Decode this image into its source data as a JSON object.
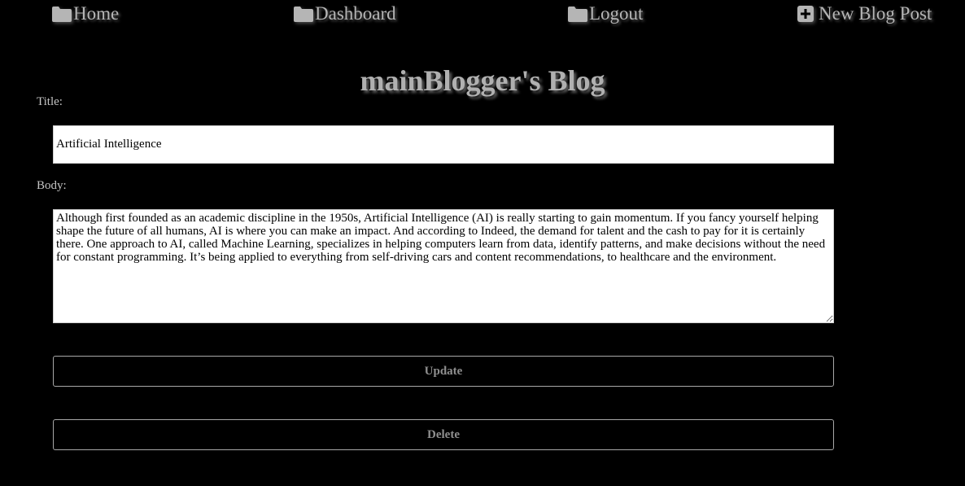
{
  "nav": {
    "home": {
      "label": "Home",
      "icon": "folder-icon"
    },
    "dashboard": {
      "label": "Dashboard",
      "icon": "folder-icon"
    },
    "logout": {
      "label": "Logout",
      "icon": "folder-icon"
    },
    "new_post": {
      "label": "New Blog Post",
      "icon": "plus-square-icon"
    }
  },
  "blog": {
    "title": "mainBlogger's Blog"
  },
  "form": {
    "title_label": "Title:",
    "title_value": "Artificial Intelligence",
    "body_label": "Body:",
    "body_value": "Although first founded as an academic discipline in the 1950s, Artificial Intelligence (AI) is really starting to gain momentum. If you fancy yourself helping shape the future of all humans, AI is where you can make an impact. And according to Indeed, the demand for talent and the cash to pay for it is certainly there. One approach to AI, called Machine Learning, specializes in helping computers learn from data, identify patterns, and make decisions without the need for constant programming. It’s being applied to everything from self-driving cars and content recommendations, to healthcare and the environment.",
    "update_label": "Update",
    "delete_label": "Delete"
  },
  "colors": {
    "background": "#000000",
    "nav_text": "#b5b5b5",
    "button_text": "#8f8f8f"
  }
}
